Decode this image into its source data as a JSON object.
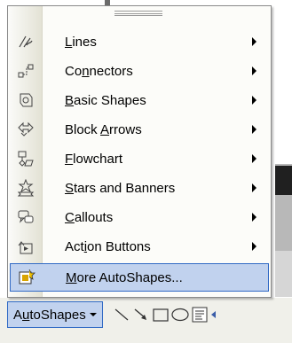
{
  "menu": {
    "items": [
      {
        "name": "Lines",
        "before": "",
        "key": "L",
        "after": "ines",
        "submenu": true,
        "icon": "lines-icon"
      },
      {
        "name": "Connectors",
        "before": "Co",
        "key": "n",
        "after": "nectors",
        "submenu": true,
        "icon": "connectors-icon"
      },
      {
        "name": "Basic Shapes",
        "before": "",
        "key": "B",
        "after": "asic Shapes",
        "submenu": true,
        "icon": "basic-shapes-icon"
      },
      {
        "name": "Block Arrows",
        "before": "Block ",
        "key": "A",
        "after": "rrows",
        "submenu": true,
        "icon": "block-arrows-icon"
      },
      {
        "name": "Flowchart",
        "before": "",
        "key": "F",
        "after": "lowchart",
        "submenu": true,
        "icon": "flowchart-icon"
      },
      {
        "name": "Stars and Banners",
        "before": "",
        "key": "S",
        "after": "tars and Banners",
        "submenu": true,
        "icon": "stars-banners-icon"
      },
      {
        "name": "Callouts",
        "before": "",
        "key": "C",
        "after": "allouts",
        "submenu": true,
        "icon": "callouts-icon"
      },
      {
        "name": "Action Buttons",
        "before": "Act",
        "key": "i",
        "after": "on Buttons",
        "submenu": true,
        "icon": "action-buttons-icon"
      },
      {
        "name": "More AutoShapes...",
        "before": "",
        "key": "M",
        "after": "ore AutoShapes...",
        "submenu": false,
        "icon": "more-autoshapes-icon",
        "highlighted": true
      }
    ]
  },
  "toolbar": {
    "autoshapes": {
      "before": "A",
      "key": "u",
      "after": "toShapes"
    },
    "tools": [
      "line-tool-icon",
      "arrow-tool-icon",
      "rectangle-tool-icon",
      "oval-tool-icon",
      "text-box-tool-icon"
    ]
  },
  "colors": {
    "highlight_fill": "#c1d2ee",
    "highlight_border": "#316ac5",
    "menu_background": "#fcfcf9"
  }
}
